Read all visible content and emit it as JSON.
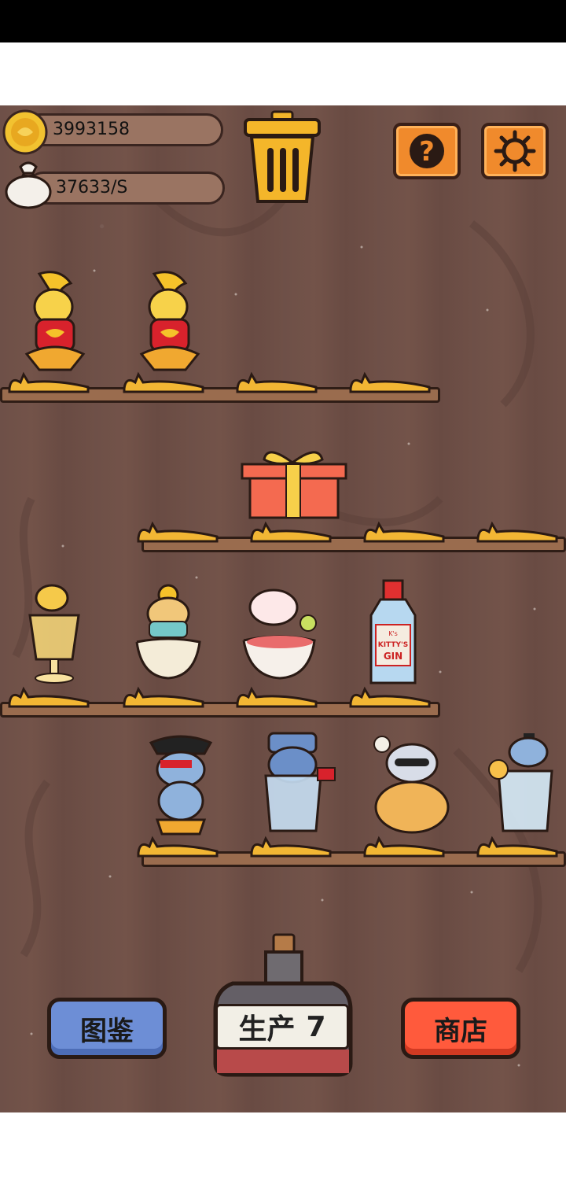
{
  "hud": {
    "coins": "3993158",
    "income_rate": "37633/S",
    "coin_icon": "gold-coin-icon",
    "bag_icon": "money-bag-icon",
    "trash_icon": "trash-can-icon",
    "help_icon": "question-mark-icon",
    "settings_icon": "gear-icon"
  },
  "shelves": [
    {
      "row": 1,
      "items": [
        "golden-cat-with-drum",
        "golden-cat-with-drum",
        "empty",
        "empty"
      ]
    },
    {
      "row": 2,
      "items": [
        "empty",
        "gift-box",
        "empty",
        "empty"
      ]
    },
    {
      "row": 3,
      "items": [
        "cat-in-beer-glass",
        "emperor-cat-in-bowl",
        "cat-in-noodle-bowl",
        "kittys-gin-bottle"
      ]
    },
    {
      "row": 4,
      "items": [
        "pirate-cat",
        "russian-cat-in-glass",
        "cowboy-cat-in-basket",
        "cat-in-cocktail-glass"
      ]
    }
  ],
  "gin_label": {
    "line1": "K's",
    "line2": "KITTY'S",
    "line3": "GIN"
  },
  "bottom": {
    "catalog_label": "图鉴",
    "produce_label": "生产",
    "produce_count": "7",
    "shop_label": "商店"
  },
  "colors": {
    "wood": "#6e5048",
    "shelf": "#9a6c4e",
    "catalog_button": "#6d8ed6",
    "shop_button": "#ff5a3c",
    "icon_button": "#f08a2c",
    "coin": "#f2c230"
  }
}
